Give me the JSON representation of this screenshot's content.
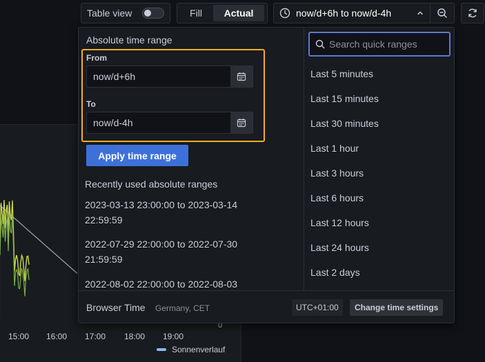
{
  "toolbar": {
    "table_view_label": "Table view",
    "table_view_on": false,
    "fill_label": "Fill",
    "actual_label": "Actual",
    "time_range_label": "now/d+6h to now/d-4h"
  },
  "chart": {
    "x_ticks": [
      "15:00",
      "16:00",
      "17:00",
      "18:00",
      "19:00"
    ],
    "y_tick_zero": "0",
    "legend": "Sonnenverlauf",
    "series_colors": [
      "#c8d94d",
      "#8ab8ff",
      "#9aa0a6"
    ]
  },
  "picker": {
    "absolute_title": "Absolute time range",
    "from_label": "From",
    "from_value": "now/d+6h",
    "to_label": "To",
    "to_value": "now/d-4h",
    "apply_label": "Apply time range",
    "recent_title": "Recently used absolute ranges",
    "recent": [
      {
        "line1": "2023-03-13 23:00:00 to 2023-03-14",
        "line2": "22:59:59"
      },
      {
        "line1": "2022-07-29 22:00:00 to 2022-07-30",
        "line2": "21:59:59"
      },
      {
        "line1": "2022-08-02 22:00:00 to 2022-08-03",
        "line2": ""
      }
    ],
    "search_placeholder": "Search quick ranges",
    "quick_ranges": [
      "Last 5 minutes",
      "Last 15 minutes",
      "Last 30 minutes",
      "Last 1 hour",
      "Last 3 hours",
      "Last 6 hours",
      "Last 12 hours",
      "Last 24 hours",
      "Last 2 days"
    ],
    "footer": {
      "browser_time": "Browser Time",
      "timezone": "Germany, CET",
      "utc_offset": "UTC+01:00",
      "change_settings": "Change time settings"
    }
  }
}
